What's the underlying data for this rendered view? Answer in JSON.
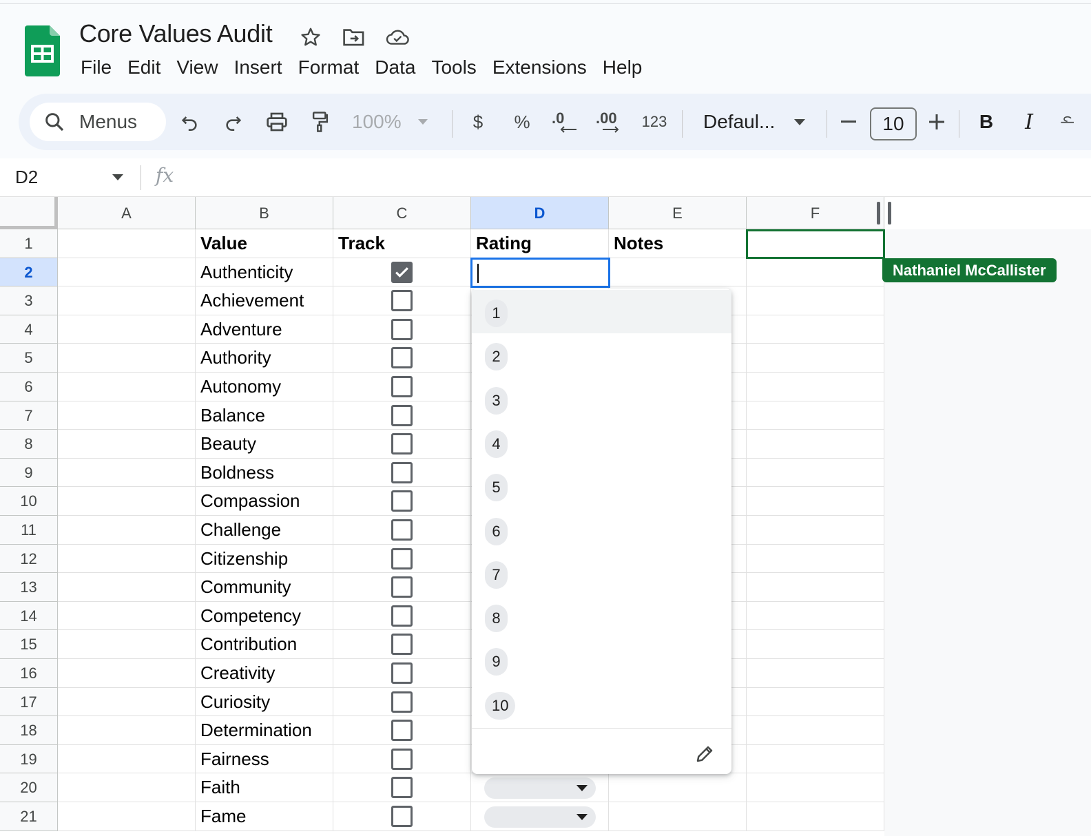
{
  "doc": {
    "title": "Core Values Audit"
  },
  "menu": [
    "File",
    "Edit",
    "View",
    "Insert",
    "Format",
    "Data",
    "Tools",
    "Extensions",
    "Help"
  ],
  "toolbar": {
    "search_label": "Menus",
    "zoom": "100%",
    "currency": "$",
    "percent": "%",
    "dec_decrease": ".0",
    "dec_increase": ".00",
    "format_number": "123",
    "font": "Defaul...",
    "font_size": "10",
    "bold": "B",
    "italic": "I"
  },
  "formula": {
    "cell_ref": "D2",
    "fx": "fx"
  },
  "columns": [
    "A",
    "B",
    "C",
    "D",
    "E",
    "F"
  ],
  "selected_column": "D",
  "row_numbers": [
    "1",
    "2",
    "3",
    "4",
    "5",
    "6",
    "7",
    "8",
    "9",
    "10",
    "11",
    "12",
    "13",
    "14",
    "15",
    "16",
    "17",
    "18",
    "19",
    "20",
    "21"
  ],
  "headers": {
    "value": "Value",
    "track": "Track",
    "rating": "Rating",
    "notes": "Notes"
  },
  "values": [
    "Authenticity",
    "Achievement",
    "Adventure",
    "Authority",
    "Autonomy",
    "Balance",
    "Beauty",
    "Boldness",
    "Compassion",
    "Challenge",
    "Citizenship",
    "Community",
    "Competency",
    "Contribution",
    "Creativity",
    "Curiosity",
    "Determination",
    "Fairness",
    "Faith",
    "Fame"
  ],
  "tracked": [
    true,
    false,
    false,
    false,
    false,
    false,
    false,
    false,
    false,
    false,
    false,
    false,
    false,
    false,
    false,
    false,
    false,
    false,
    false,
    false
  ],
  "collaborator": {
    "name": "Nathaniel McCallister",
    "color": "#137333"
  },
  "rating_dropdown": {
    "options": [
      "1",
      "2",
      "3",
      "4",
      "5",
      "6",
      "7",
      "8",
      "9",
      "10"
    ],
    "highlighted": "1"
  },
  "colors": {
    "selection": "#1a73e8",
    "header_selected": "#d3e3fd",
    "sheets_green": "#0f9d58"
  }
}
